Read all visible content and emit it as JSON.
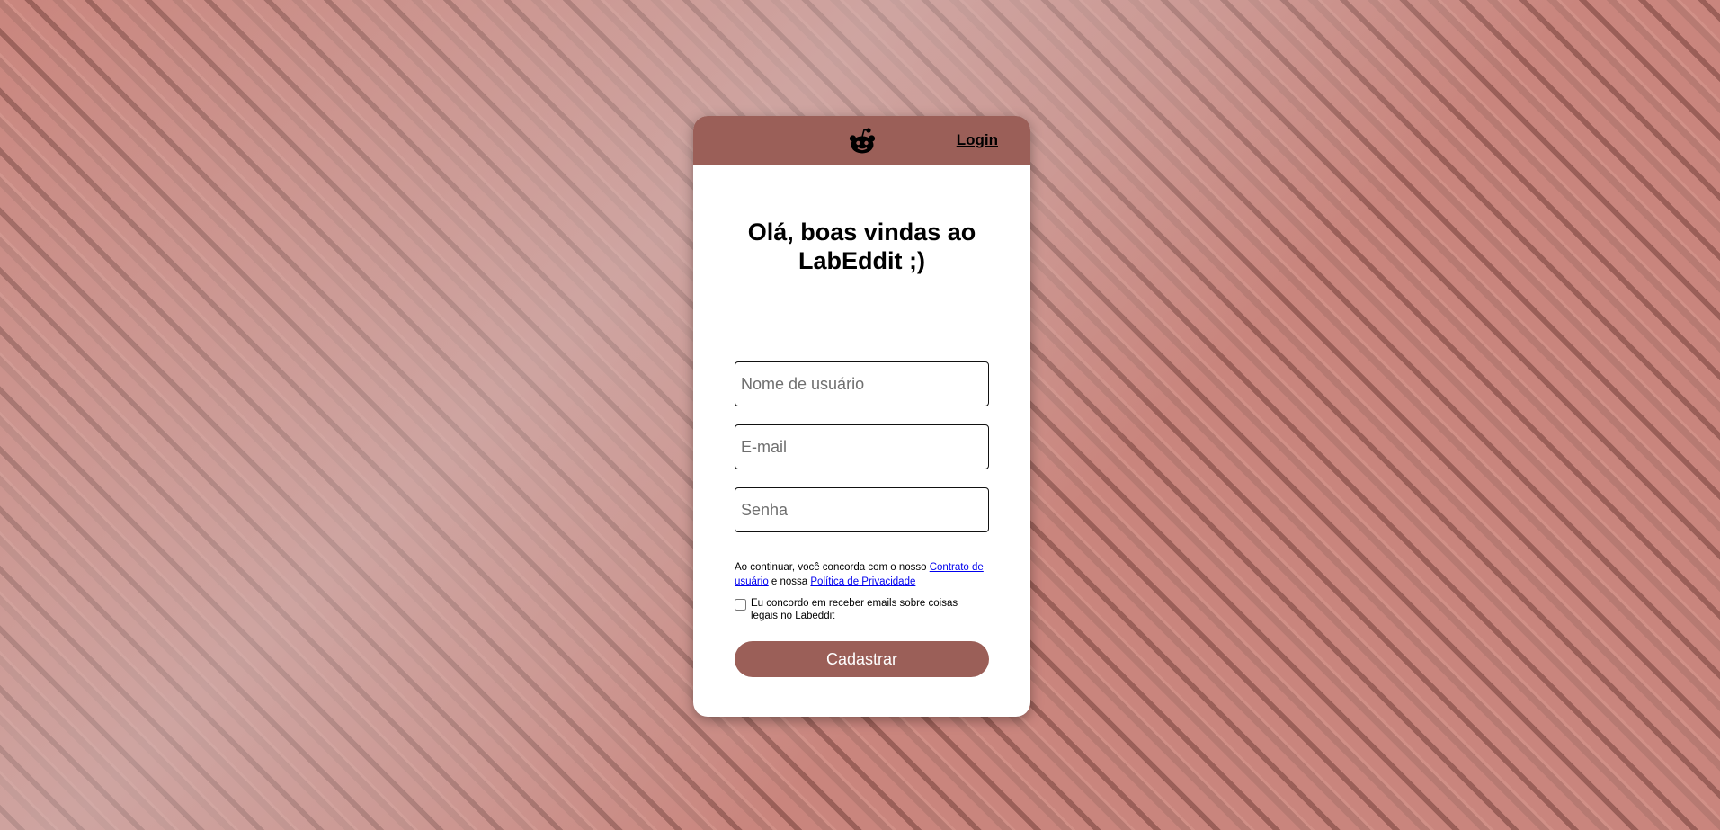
{
  "header": {
    "logo_icon": "reddit-alien-icon",
    "login_label": "Login"
  },
  "title": {
    "line1": "Olá, boas vindas ao",
    "line2": "LabEddit ;)"
  },
  "form": {
    "username": {
      "placeholder": "Nome de usuário",
      "value": ""
    },
    "email": {
      "placeholder": "E-mail",
      "value": ""
    },
    "password": {
      "placeholder": "Senha",
      "value": ""
    },
    "terms": {
      "prefix": "Ao continuar, você concorda com o nosso ",
      "user_agreement": "Contrato de usuário",
      "middle": " e nossa ",
      "privacy_policy": "Política de Privacidade"
    },
    "consent_label": "Eu concordo em receber emails sobre coisas legais no Labeddit",
    "consent_checked": false,
    "submit_label": "Cadastrar"
  },
  "colors": {
    "brand": "#9b5f58",
    "background": "#c9877e",
    "link": "#0000ee"
  }
}
